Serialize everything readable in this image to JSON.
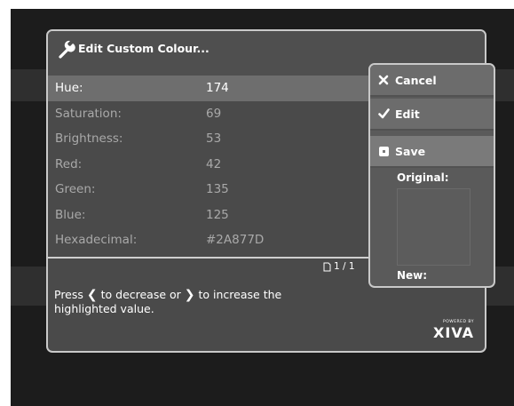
{
  "dialog": {
    "title": "Edit Custom Colour...",
    "icon": "wrench-icon"
  },
  "rows": [
    {
      "label": "Hue:",
      "value": "174",
      "highlighted": true
    },
    {
      "label": "Saturation:",
      "value": "69"
    },
    {
      "label": "Brightness:",
      "value": "53"
    },
    {
      "label": "Red:",
      "value": "42"
    },
    {
      "label": "Green:",
      "value": "135"
    },
    {
      "label": "Blue:",
      "value": "125"
    },
    {
      "label": "Hexadecimal:",
      "value": "#2A877D"
    }
  ],
  "page_indicator": "1 / 1",
  "hint": {
    "part1": "Press",
    "part2": "to decrease or",
    "part3": "to increase the highlighted value."
  },
  "powered": {
    "small": "POWERED BY",
    "brand": "XIVA"
  },
  "menu": {
    "cancel": "Cancel",
    "edit": "Edit",
    "save": "Save",
    "original_label": "Original:",
    "new_label": "New:"
  },
  "colors": {
    "original_swatch": "#5c5c5c"
  }
}
